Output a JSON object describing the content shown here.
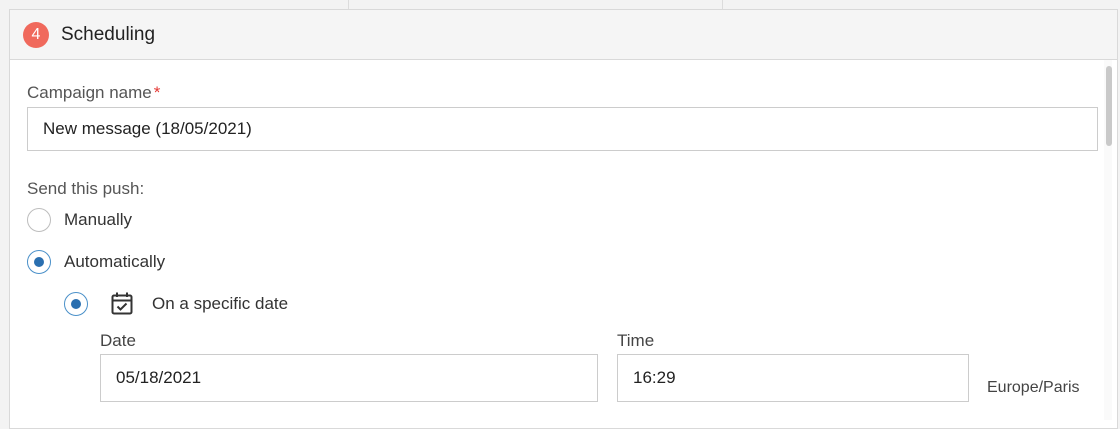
{
  "section": {
    "step_number": "4",
    "title": "Scheduling"
  },
  "campaign": {
    "label": "Campaign name",
    "required_mark": "*",
    "value": "New message (18/05/2021)"
  },
  "send": {
    "label": "Send this push:",
    "options": [
      {
        "label": "Manually",
        "checked": false
      },
      {
        "label": "Automatically",
        "checked": true
      }
    ],
    "sub_options": [
      {
        "label": "On a specific date",
        "checked": true,
        "icon": "calendar-check-icon"
      }
    ]
  },
  "schedule": {
    "date_label": "Date",
    "date_value": "05/18/2021",
    "time_label": "Time",
    "time_value": "16:29",
    "timezone": "Europe/Paris"
  },
  "colors": {
    "badge": "#f0695c",
    "radio_checked": "#2a6fb0",
    "required": "#e53935"
  }
}
